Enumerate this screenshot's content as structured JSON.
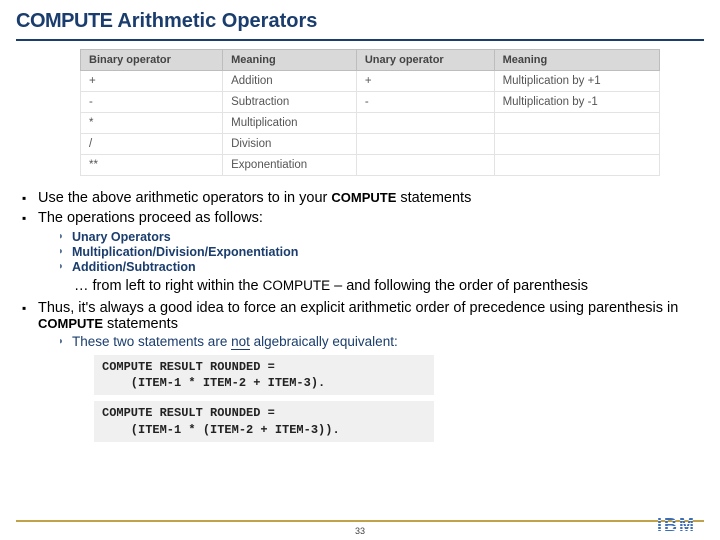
{
  "title_keyword": "COMPUTE",
  "title_rest": " Arithmetic Operators",
  "table": {
    "headers": [
      "Binary operator",
      "Meaning",
      "Unary operator",
      "Meaning"
    ],
    "rows": [
      [
        "+",
        "Addition",
        "+",
        "Multiplication by +1"
      ],
      [
        "-",
        "Subtraction",
        "-",
        "Multiplication by -1"
      ],
      [
        "*",
        "Multiplication",
        "",
        ""
      ],
      [
        "/",
        "Division",
        "",
        ""
      ],
      [
        "**",
        "Exponentiation",
        "",
        ""
      ]
    ]
  },
  "bullets": {
    "b1a": "Use the above arithmetic operators to in your ",
    "b1kw": "COMPUTE",
    "b1b": " statements",
    "b2": "The operations proceed as follows:",
    "order": [
      "Unary Operators",
      "Multiplication/Division/Exponentiation",
      "Addition/Subtraction"
    ],
    "para_a": "… from left to right within the ",
    "para_kw": "COMPUTE",
    "para_b": " – and following the order of parenthesis",
    "b3a": "Thus, it's always a good idea to force an explicit arithmetic order of precedence using parenthesis in ",
    "b3kw": "COMPUTE",
    "b3b": " statements",
    "sub2_a": "These two statements are ",
    "sub2_not": "not",
    "sub2_b": " algebraically equivalent:"
  },
  "code1": "COMPUTE RESULT ROUNDED =\n    (ITEM-1 * ITEM-2 + ITEM-3).",
  "code2": "COMPUTE RESULT ROUNDED =\n    (ITEM-1 * (ITEM-2 + ITEM-3)).",
  "page_num": "33",
  "logo_text": "IBM"
}
